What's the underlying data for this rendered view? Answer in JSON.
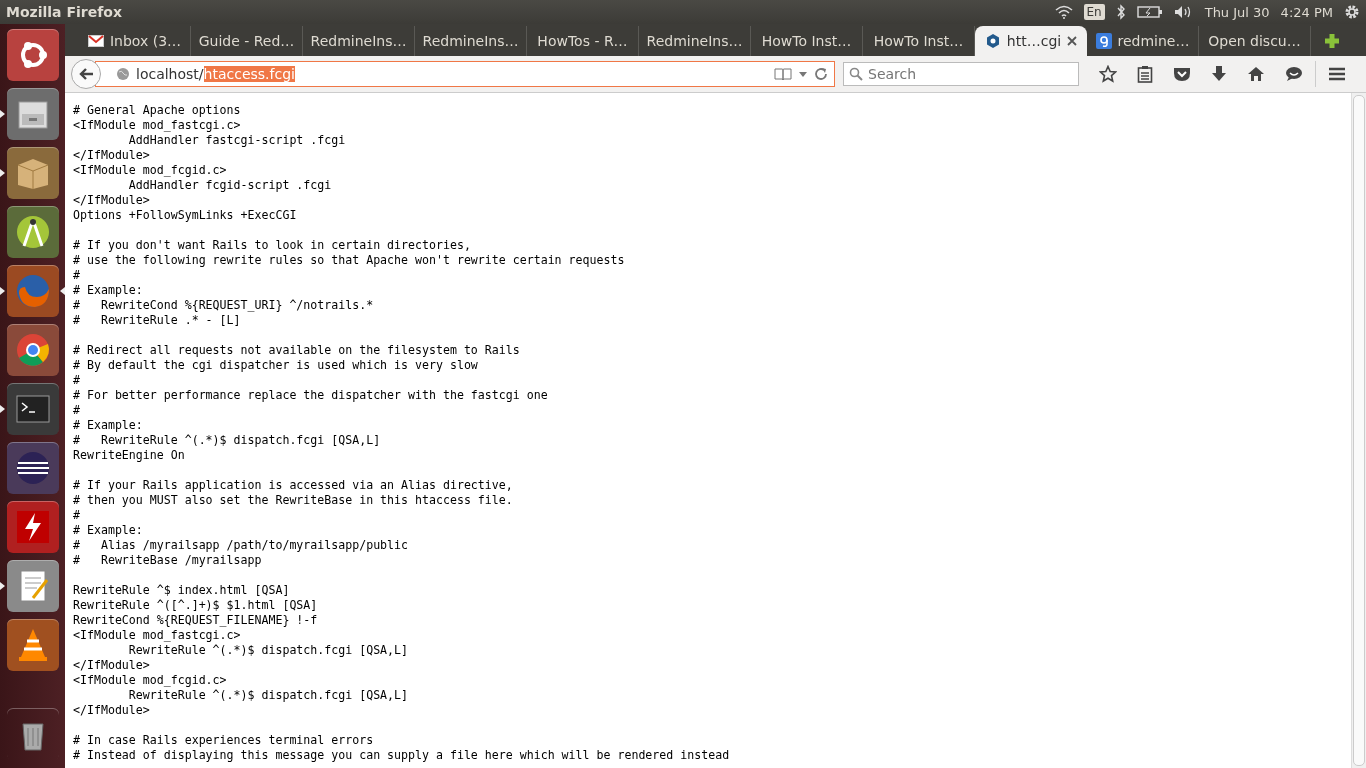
{
  "top_panel": {
    "title": "Mozilla Firefox",
    "keyboard_layout": "En",
    "date": "Thu Jul 30",
    "time": "4:24 PM"
  },
  "launcher": [
    {
      "kind": "ubuntu",
      "running": false,
      "focused": false
    },
    {
      "kind": "files",
      "running": true,
      "focused": false
    },
    {
      "kind": "archive",
      "running": true,
      "focused": false
    },
    {
      "kind": "compass",
      "running": false,
      "focused": false
    },
    {
      "kind": "firefox",
      "running": true,
      "focused": true
    },
    {
      "kind": "chrome",
      "running": false,
      "focused": false
    },
    {
      "kind": "terminal",
      "running": true,
      "focused": false
    },
    {
      "kind": "eclipse",
      "running": false,
      "focused": false
    },
    {
      "kind": "filezilla",
      "running": false,
      "focused": false
    },
    {
      "kind": "editor",
      "running": true,
      "focused": false
    },
    {
      "kind": "vlc",
      "running": false,
      "focused": false
    },
    {
      "kind": "trash",
      "running": false,
      "focused": false
    }
  ],
  "tabs": [
    {
      "label": "Inbox (3…",
      "kind": "mail",
      "selected": false
    },
    {
      "label": "Guide - Red…",
      "kind": "plain",
      "selected": false
    },
    {
      "label": "RedmineIns…",
      "kind": "plain",
      "selected": false
    },
    {
      "label": "RedmineIns…",
      "kind": "plain",
      "selected": false
    },
    {
      "label": "HowTos - R…",
      "kind": "plain",
      "selected": false
    },
    {
      "label": "RedmineIns…",
      "kind": "plain",
      "selected": false
    },
    {
      "label": "HowTo Inst…",
      "kind": "plain",
      "selected": false
    },
    {
      "label": "HowTo Inst…",
      "kind": "plain",
      "selected": false
    },
    {
      "label": "htt…cgi",
      "kind": "hexagon",
      "selected": true
    },
    {
      "label": "redmine…",
      "kind": "search",
      "selected": false
    },
    {
      "label": "Open discu…",
      "kind": "plain",
      "selected": false
    }
  ],
  "address_bar": {
    "host": "localhost/",
    "selected_text": "htaccess.fcgi"
  },
  "search": {
    "placeholder": "Search"
  },
  "document": [
    {
      "lines": [
        "# General Apache options",
        "<IfModule mod_fastcgi.c>",
        "        AddHandler fastcgi-script .fcgi",
        "</IfModule>",
        "<IfModule mod_fcgid.c>",
        "        AddHandler fcgid-script .fcgi",
        "</IfModule>",
        "Options +FollowSymLinks +ExecCGI"
      ]
    },
    {
      "lines": [
        "# If you don't want Rails to look in certain directories,",
        "# use the following rewrite rules so that Apache won't rewrite certain requests",
        "#",
        "# Example:",
        "#   RewriteCond %{REQUEST_URI} ^/notrails.*",
        "#   RewriteRule .* - [L]"
      ]
    },
    {
      "lines": [
        "# Redirect all requests not available on the filesystem to Rails",
        "# By default the cgi dispatcher is used which is very slow",
        "#",
        "# For better performance replace the dispatcher with the fastcgi one",
        "#",
        "# Example:",
        "#   RewriteRule ^(.*)$ dispatch.fcgi [QSA,L]",
        "RewriteEngine On"
      ]
    },
    {
      "lines": [
        "# If your Rails application is accessed via an Alias directive,",
        "# then you MUST also set the RewriteBase in this htaccess file.",
        "#",
        "# Example:",
        "#   Alias /myrailsapp /path/to/myrailsapp/public",
        "#   RewriteBase /myrailsapp"
      ]
    },
    {
      "lines": [
        "RewriteRule ^$ index.html [QSA]",
        "RewriteRule ^([^.]+)$ $1.html [QSA]",
        "RewriteCond %{REQUEST_FILENAME} !-f",
        "<IfModule mod_fastcgi.c>",
        "        RewriteRule ^(.*)$ dispatch.fcgi [QSA,L]",
        "</IfModule>",
        "<IfModule mod_fcgid.c>",
        "        RewriteRule ^(.*)$ dispatch.fcgi [QSA,L]",
        "</IfModule>"
      ]
    },
    {
      "lines": [
        "# In case Rails experiences terminal errors",
        "# Instead of displaying this message you can supply a file here which will be rendered instead"
      ]
    }
  ]
}
